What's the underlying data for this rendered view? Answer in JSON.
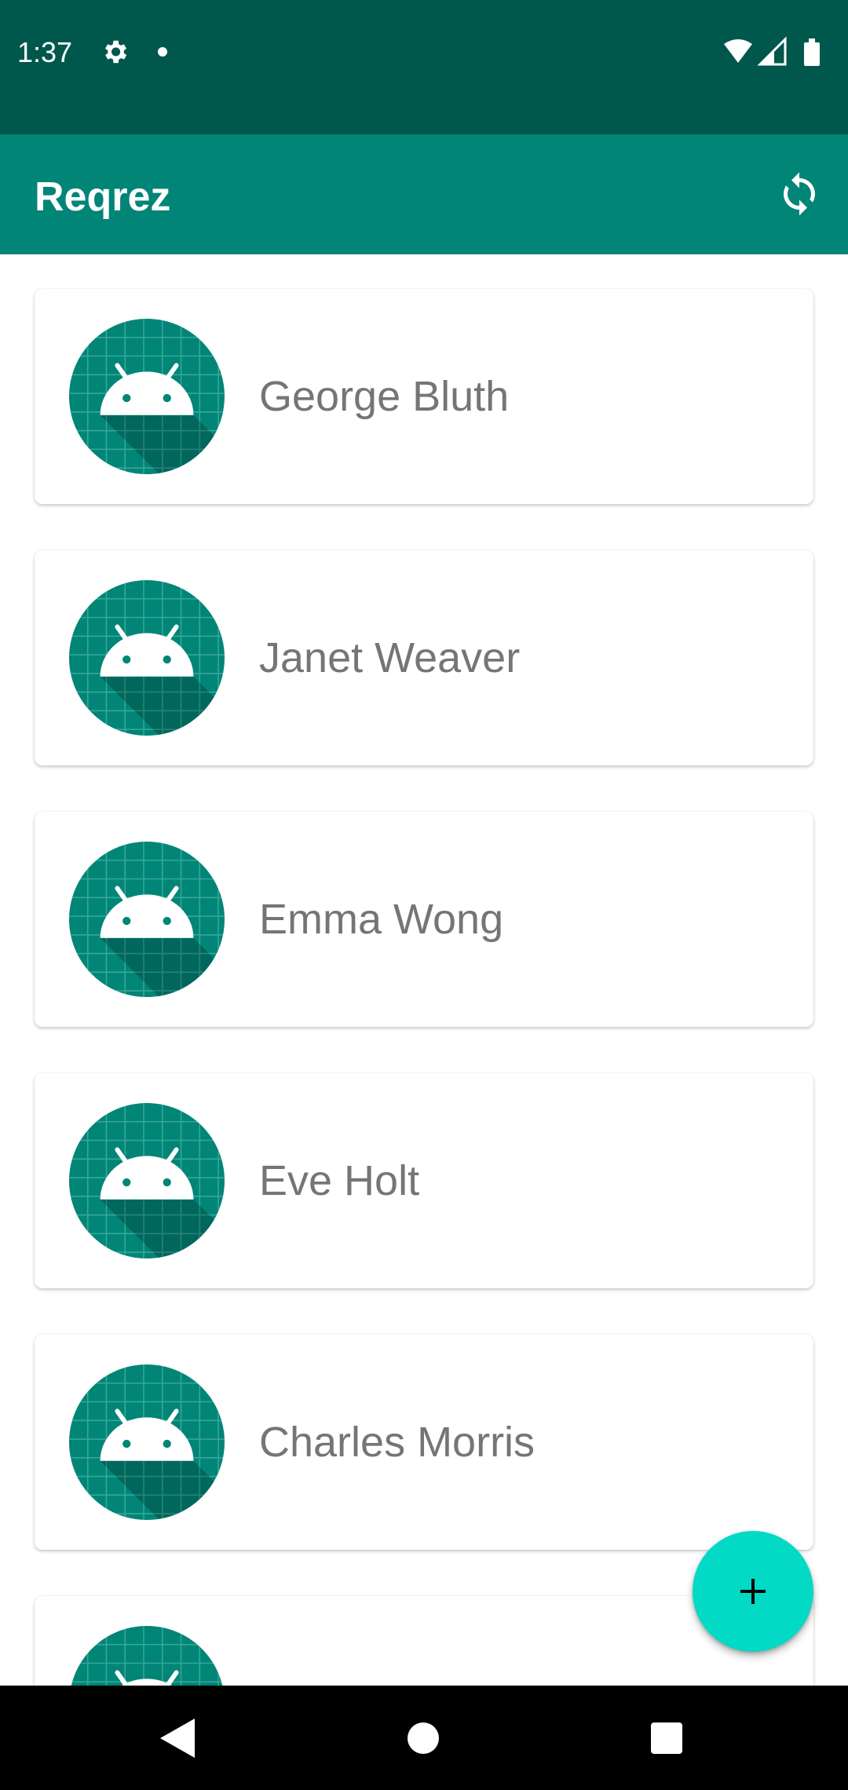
{
  "status_bar": {
    "time": "1:37",
    "icons": [
      "gear-icon",
      "notification-dot",
      "wifi-icon",
      "cell-signal-icon",
      "battery-icon"
    ]
  },
  "app_bar": {
    "title": "Reqrez",
    "action_icon": "refresh-icon"
  },
  "users": [
    {
      "name": "George Bluth"
    },
    {
      "name": "Janet Weaver"
    },
    {
      "name": "Emma Wong"
    },
    {
      "name": "Eve Holt"
    },
    {
      "name": "Charles Morris"
    },
    {
      "name": ""
    }
  ],
  "fab": {
    "icon": "plus-icon"
  },
  "nav_bar": {
    "icons": [
      "back-icon",
      "home-icon",
      "recents-icon"
    ]
  },
  "colors": {
    "status_bar": "#00574b",
    "app_bar": "#008577",
    "fab": "#03dac5",
    "name_text": "#757575"
  }
}
